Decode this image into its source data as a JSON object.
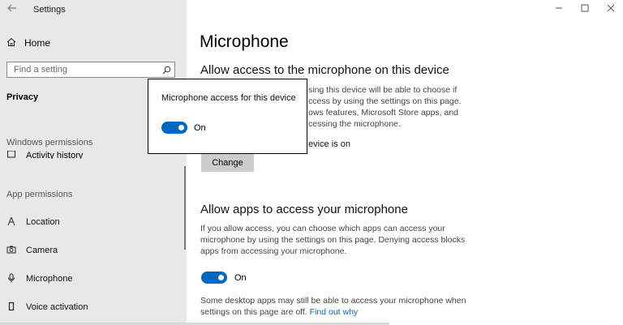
{
  "app": {
    "title": "Settings"
  },
  "sidebar": {
    "home_label": "Home",
    "search_placeholder": "Find a setting",
    "current_category": "Privacy",
    "windows_permissions_header": "Windows permissions",
    "partial_item": "Activity history",
    "app_permissions_header": "App permissions",
    "items": [
      {
        "label": "Location",
        "icon": "location-icon"
      },
      {
        "label": "Camera",
        "icon": "camera-icon"
      },
      {
        "label": "Microphone",
        "icon": "microphone-icon"
      },
      {
        "label": "Voice activation",
        "icon": "voice-activation-icon"
      }
    ]
  },
  "main": {
    "title": "Microphone",
    "section1": {
      "heading": "Allow access to the microphone on this device",
      "desc_visible": "sing this device will be able to choose if\nccess by using the settings on this page.\nows features, Microsoft Store apps, and\ncessing the microphone.",
      "status_visible": "evice is on",
      "change_label": "Change"
    },
    "section2": {
      "heading": "Allow apps to access your microphone",
      "desc": "If you allow access, you can choose which apps can access your microphone by using the settings on this page. Denying access blocks apps from accessing your microphone.",
      "toggle_state": "On",
      "note": "Some desktop apps may still be able to access your microphone when settings on this page are off.",
      "note_link": "Find out why"
    }
  },
  "popup": {
    "title": "Microphone access for this device",
    "toggle_state": "On"
  },
  "colors": {
    "accent": "#0067c0",
    "sidebar_bg": "#e8e8e8",
    "button_bg": "#cccccc"
  }
}
